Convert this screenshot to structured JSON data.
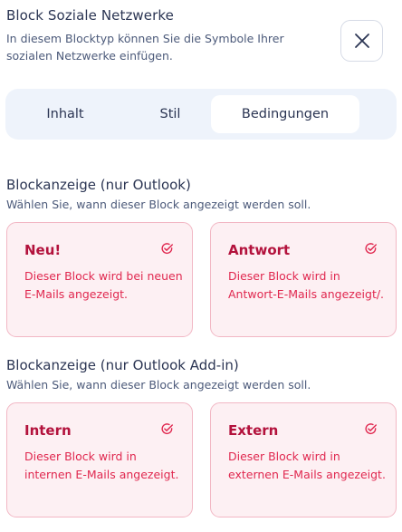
{
  "header": {
    "title": "Block Soziale Netzwerke",
    "subtitle": "In diesem Blocktyp können Sie die Symbole Ihrer sozialen Netzwerke einfügen."
  },
  "tabs": [
    {
      "label": "Inhalt",
      "active": false
    },
    {
      "label": "Stil",
      "active": false
    },
    {
      "label": "Bedingungen",
      "active": true
    }
  ],
  "sections": [
    {
      "title": "Blockanzeige (nur Outlook)",
      "subtitle": "Wählen Sie, wann dieser Block angezeigt werden soll.",
      "cards": [
        {
          "title": "Neu!",
          "description": "Dieser Block wird bei neuen E-Mails angezeigt.",
          "selected": true
        },
        {
          "title": "Antwort",
          "description": "Dieser Block wird in Antwort-E-Mails angezeigt/.",
          "selected": true
        }
      ]
    },
    {
      "title": "Blockanzeige (nur Outlook Add-in)",
      "subtitle": "Wählen Sie, wann dieser Block angezeigt werden soll.",
      "cards": [
        {
          "title": "Intern",
          "description": "Dieser Block wird in internen E-Mails angezeigt.",
          "selected": true
        },
        {
          "title": "Extern",
          "description": "Dieser Block wird in externen E-Mails angezeigt.",
          "selected": true
        }
      ]
    }
  ],
  "colors": {
    "accent": "#e0284f",
    "card_title": "#b3123c",
    "card_bg": "#fdf0f3",
    "card_border": "#f2b7c4",
    "tabs_bg": "#eef3fb"
  },
  "icons": {
    "close": "close-icon",
    "check": "check-circle-icon"
  }
}
